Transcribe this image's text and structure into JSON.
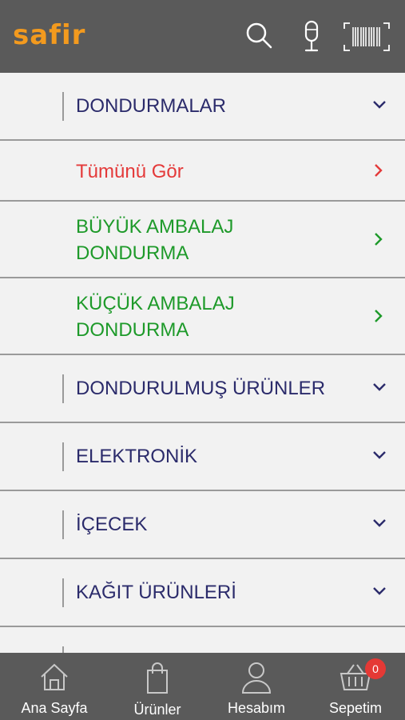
{
  "header": {
    "logo_text": "safir",
    "icons": [
      "search-icon",
      "microphone-icon",
      "barcode-icon"
    ],
    "background": "#5a5a5a",
    "logo_color": "#f39a1e"
  },
  "menu": {
    "items": [
      {
        "label": "DONDURMALAR",
        "kind": "category",
        "expanded": true
      },
      {
        "label": "Tümünü Gör",
        "kind": "view-all"
      },
      {
        "label": "BÜYÜK AMBALAJ\nDONDURMA",
        "kind": "subcategory"
      },
      {
        "label": "KÜÇÜK AMBALAJ\nDONDURMA",
        "kind": "subcategory"
      },
      {
        "label": "DONDURULMUŞ ÜRÜNLER",
        "kind": "category"
      },
      {
        "label": "ELEKTRONİK",
        "kind": "category"
      },
      {
        "label": "İÇECEK",
        "kind": "category"
      },
      {
        "label": "KAĞIT ÜRÜNLERİ",
        "kind": "category"
      }
    ],
    "colors": {
      "category": "#2b2b6b",
      "view_all": "#e43a3a",
      "subcategory": "#1e9a2a"
    }
  },
  "tabbar": {
    "tabs": [
      {
        "label": "Ana Sayfa",
        "icon": "home-icon"
      },
      {
        "label": "Ürünler",
        "icon": "shopping-bag-icon"
      },
      {
        "label": "Hesabım",
        "icon": "user-icon"
      },
      {
        "label": "Sepetim",
        "icon": "basket-icon"
      }
    ],
    "cart_count": "0",
    "badge_color": "#e53935"
  }
}
